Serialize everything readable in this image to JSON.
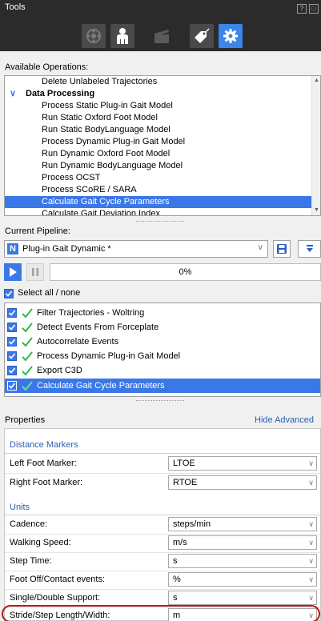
{
  "window": {
    "title": "Tools"
  },
  "toolbar": {
    "icons": [
      "film-reel-icon",
      "person-icon",
      "clapper-icon",
      "tag-icon",
      "gear-icon"
    ],
    "accent": "#3b86e8"
  },
  "available": {
    "label": "Available Operations:",
    "items": [
      {
        "text": "Delete Unlabeled Trajectories",
        "type": "item"
      },
      {
        "text": "Data Processing",
        "type": "category"
      },
      {
        "text": "Process Static Plug-in Gait Model",
        "type": "item"
      },
      {
        "text": "Run Static Oxford Foot Model",
        "type": "item"
      },
      {
        "text": "Run Static BodyLanguage Model",
        "type": "item"
      },
      {
        "text": "Process Dynamic Plug-in Gait Model",
        "type": "item"
      },
      {
        "text": "Run Dynamic Oxford Foot Model",
        "type": "item"
      },
      {
        "text": "Run Dynamic BodyLanguage Model",
        "type": "item"
      },
      {
        "text": "Process OCST",
        "type": "item"
      },
      {
        "text": "Process SCoRE / SARA",
        "type": "item"
      },
      {
        "text": "Calculate Gait Cycle Parameters",
        "type": "selected"
      },
      {
        "text": "Calculate Gait Deviation Index",
        "type": "item"
      }
    ]
  },
  "pipeline": {
    "label": "Current Pipeline:",
    "name": "Plug-in Gait Dynamic *",
    "progress_text": "0%",
    "progress": 0,
    "select_all": "Select all / none",
    "steps": [
      {
        "text": "Filter Trajectories - Woltring",
        "selected": false
      },
      {
        "text": "Detect Events From Forceplate",
        "selected": false
      },
      {
        "text": "Autocorrelate Events",
        "selected": false
      },
      {
        "text": "Process Dynamic Plug-in Gait Model",
        "selected": false
      },
      {
        "text": "Export C3D",
        "selected": false
      },
      {
        "text": "Calculate Gait Cycle Parameters",
        "selected": true
      }
    ]
  },
  "properties": {
    "label": "Properties",
    "toggle": "Hide Advanced",
    "distance": {
      "title": "Distance Markers",
      "rows": [
        {
          "label": "Left Foot Marker:",
          "value": "LTOE"
        },
        {
          "label": "Right Foot Marker:",
          "value": "RTOE"
        }
      ]
    },
    "units": {
      "title": "Units",
      "rows": [
        {
          "label": "Cadence:",
          "value": "steps/min"
        },
        {
          "label": "Walking Speed:",
          "value": "m/s"
        },
        {
          "label": "Step Time:",
          "value": "s"
        },
        {
          "label": "Foot Off/Contact events:",
          "value": "%"
        },
        {
          "label": "Single/Double Support:",
          "value": "s"
        },
        {
          "label": "Stride/Step Length/Width:",
          "value": "m"
        }
      ]
    }
  }
}
